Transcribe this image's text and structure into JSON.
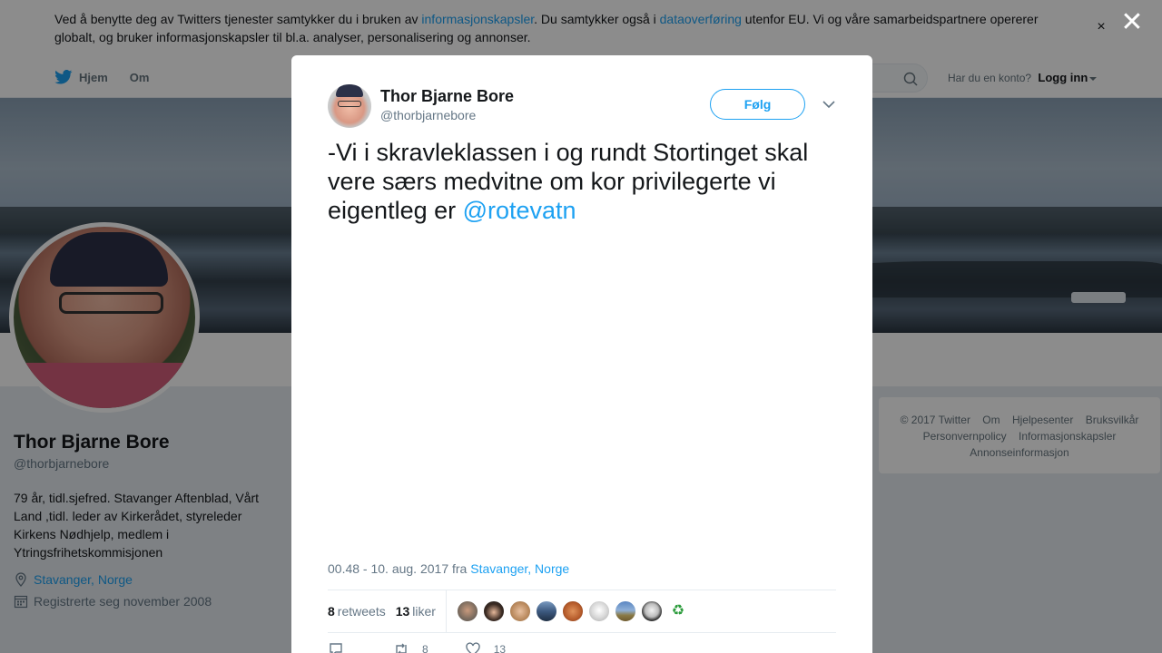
{
  "cookie_banner": {
    "text_1": "Ved å benytte deg av Twitters tjenester samtykker du i bruken av ",
    "link_1": "informasjonskapsler",
    "text_2": ". Du samtykker også i ",
    "link_2": "dataoverføring",
    "text_3": " utenfor EU. Vi og våre samarbeidspartnere opererer globalt, og bruker informasjonskapsler til bl.a. analyser, personalisering og annonser.",
    "close": "×"
  },
  "overlay_close": "✕",
  "nav": {
    "home": "Hjem",
    "about": "Om",
    "account_prompt": "Har du en konto?",
    "login": "Logg inn"
  },
  "profile": {
    "name": "Thor Bjarne Bore",
    "handle": "@thorbjarnebore",
    "bio": "79 år, tidl.sjefred. Stavanger Aftenblad, Vårt Land ,tidl. leder av Kirkerådet, styreleder Kirkens Nødhjelp, medlem i Ytringsfrihetskommisjonen",
    "location": "Stavanger, Norge",
    "joined": "Registrerte seg november 2008"
  },
  "footer": {
    "items": [
      "© 2017 Twitter",
      "Om",
      "Hjelpesenter",
      "Bruksvilkår",
      "Personvernpolicy",
      "Informasjonskapsler",
      "Annonseinformasjon"
    ]
  },
  "tweet": {
    "author_name": "Thor Bjarne Bore",
    "author_handle": "@thorbjarnebore",
    "follow_label": "Følg",
    "text": "-Vi i skravleklassen i og rundt Stortinget skal vere særs medvitne om kor privilegerte vi eigentleg er ",
    "mention": "@rotevatn",
    "timestamp": "00.48 - 10. aug. 2017 fra ",
    "place": "Stavanger, Norge",
    "retweets_count": "8",
    "retweets_label": "retweets",
    "likes_count": "13",
    "likes_label": "liker",
    "action_retweet_count": "8",
    "action_like_count": "13"
  },
  "colors": {
    "accent": "#1da1f2",
    "text": "#14171a",
    "muted": "#657786"
  }
}
